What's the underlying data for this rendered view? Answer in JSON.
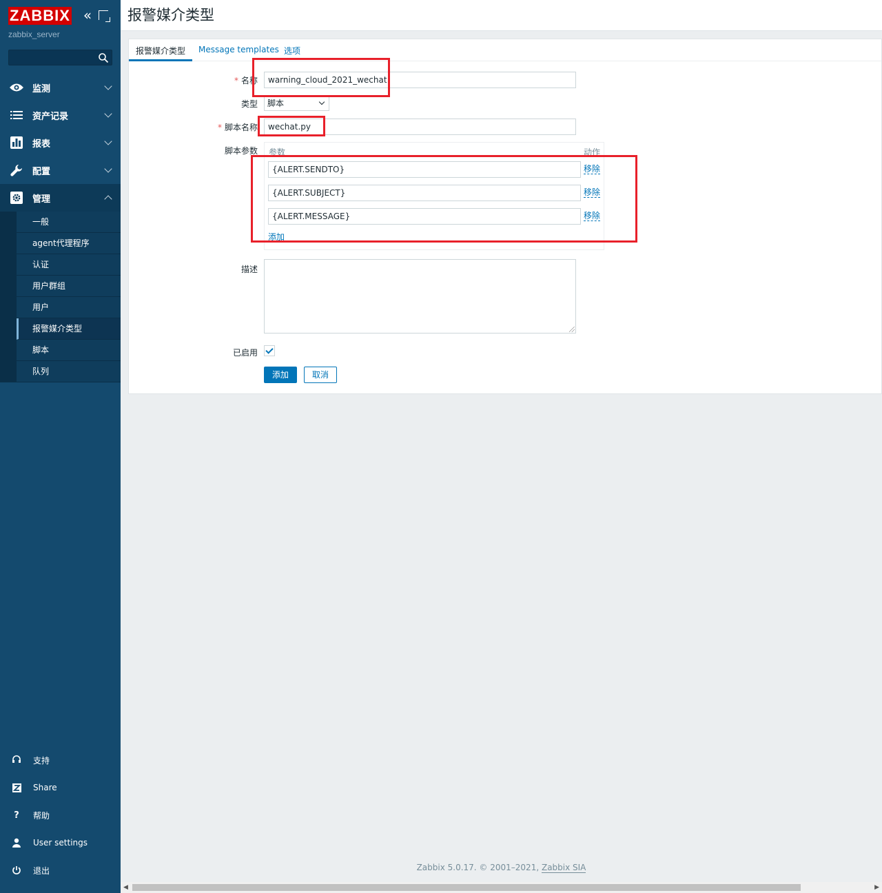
{
  "sidebar": {
    "logo": "ZABBIX",
    "server_name": "zabbix_server",
    "search_placeholder": "",
    "menu": [
      {
        "label": "监测",
        "icon": "eye-icon"
      },
      {
        "label": "资产记录",
        "icon": "list-icon"
      },
      {
        "label": "报表",
        "icon": "bar-chart-icon"
      },
      {
        "label": "配置",
        "icon": "wrench-icon"
      },
      {
        "label": "管理",
        "icon": "gear-icon"
      }
    ],
    "submenu": [
      "一般",
      "agent代理程序",
      "认证",
      "用户群组",
      "用户",
      "报警媒介类型",
      "脚本",
      "队列"
    ],
    "active_submenu": "报警媒介类型",
    "bottom": [
      {
        "label": "支持",
        "icon": "headset-icon"
      },
      {
        "label": "Share",
        "icon": "share-z-icon"
      },
      {
        "label": "帮助",
        "icon": "help-icon"
      },
      {
        "label": "User settings",
        "icon": "user-icon"
      },
      {
        "label": "退出",
        "icon": "power-icon"
      }
    ]
  },
  "header": {
    "title": "报警媒介类型"
  },
  "tabs": [
    "报警媒介类型",
    "Message templates",
    "选项"
  ],
  "form": {
    "name_label": "名称",
    "name_value": "warning_cloud_2021_wechat",
    "type_label": "类型",
    "type_value": "脚本",
    "script_name_label": "脚本名称",
    "script_name_value": "wechat.py",
    "script_params_label": "脚本参数",
    "params_col": "参数",
    "action_col": "动作",
    "params": [
      "{ALERT.SENDTO}",
      "{ALERT.SUBJECT}",
      "{ALERT.MESSAGE}"
    ],
    "remove_label": "移除",
    "add_param_label": "添加",
    "description_label": "描述",
    "description_value": "",
    "enabled_label": "已启用",
    "enabled": true,
    "submit_label": "添加",
    "cancel_label": "取消"
  },
  "footer": {
    "text": "Zabbix 5.0.17. © 2001–2021, ",
    "link": "Zabbix SIA"
  },
  "colors": {
    "sidebar": "#144a6e",
    "accent": "#0275b8",
    "highlight": "#e8202a",
    "logo_bg": "#d40000"
  }
}
